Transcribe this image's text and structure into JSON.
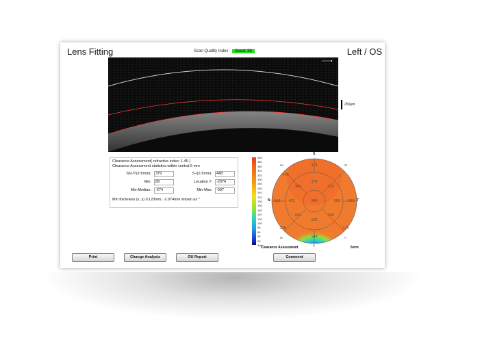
{
  "header": {
    "title": "Lens Fitting",
    "eye": "Left / OS",
    "scan_quality_label": "Scan Quality Index",
    "scan_quality_value": "Good: 38"
  },
  "scan": {
    "scale_label": "250μm"
  },
  "stats": {
    "line1": "Clearance Assessment( refractive index: 1.45 )",
    "line2": "Clearance Assessment statistics within central 5 mm",
    "fields": [
      {
        "label": "SN-IT(2-5mm):",
        "value": "379"
      },
      {
        "label": "S-I(2-5mm):",
        "value": "448"
      },
      {
        "label": "Min:",
        "value": "89"
      },
      {
        "label": "Location Y:",
        "value": "-2074"
      },
      {
        "label": "Min-Median:",
        "value": "-274"
      },
      {
        "label": "Min-Max:",
        "value": "-507"
      }
    ],
    "footer": "Min thickness (x, y) 0.123mm, -2.074mm shown as *"
  },
  "colorbar": {
    "ticks": [
      "400",
      "380",
      "360",
      "340",
      "320",
      "300",
      "280",
      "260",
      "240",
      "220",
      "200",
      "180",
      "160",
      "140",
      "120",
      "100",
      "80",
      "60",
      "40",
      "20",
      "0μm"
    ]
  },
  "map": {
    "label_superior": "S",
    "label_nasal": "N",
    "label_temporal": "T",
    "label_inferior": "I",
    "label_st": "ST",
    "label_sn": "SN",
    "label_in": "IN",
    "label_it": "IT",
    "center": "340",
    "inner": {
      "sup": "378",
      "sn": "364",
      "st": "376",
      "nasal": "423",
      "temporal": "360",
      "in": "241",
      "inf": "102",
      "it": "169"
    },
    "outer": {
      "sup": "474",
      "sn": "470",
      "nasal": "514",
      "temporal": "340",
      "in": "278",
      "inf": "149",
      "it": "171"
    },
    "footer_label": "Clearance Assessment",
    "footer_mm": "6mm"
  },
  "buttons": {
    "print": "Print",
    "change_analysis": "Change Analysis",
    "ou_report": "OU Report",
    "comment": "Comment"
  }
}
